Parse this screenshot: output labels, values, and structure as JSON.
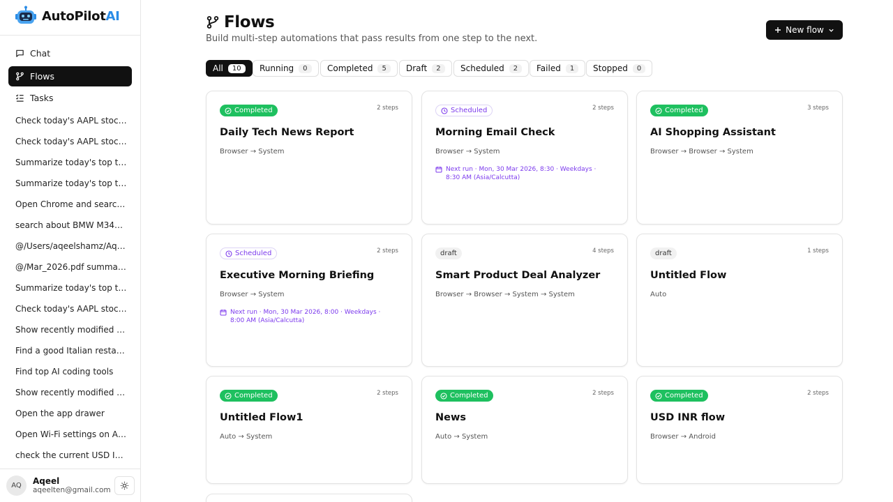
{
  "app": {
    "name": "AutoPilot",
    "name_accent": "AI",
    "accent_color": "#2b8ce6"
  },
  "nav": [
    {
      "label": "Chat",
      "icon": "chat-icon"
    },
    {
      "label": "Flows",
      "icon": "flow-icon",
      "active": true
    },
    {
      "label": "Tasks",
      "icon": "tasks-icon"
    }
  ],
  "history": [
    "Check today's AAPL stock ...",
    "Check today's AAPL stock ...",
    "Summarize today's top tec...",
    "Summarize today's top tec...",
    "Open Chrome and search f...",
    "search about BMW M340i ...",
    "@/Users/aqeelshamz/Aqe...",
    "@/Mar_2026.pdf summari...",
    "Summarize today's top tec...",
    "Check today's AAPL stock ...",
    "Show recently modified fil...",
    "Find a good Italian restaur...",
    "Find top AI coding tools",
    "Show recently modified fil...",
    "Open the app drawer",
    "Open Wi-Fi settings on An...",
    "check the current USD IN..."
  ],
  "user": {
    "initials": "AQ",
    "name": "Aqeel",
    "email": "aqeelten@gmail.com"
  },
  "header": {
    "title": "Flows",
    "subtitle": "Build multi-step automations that pass results from one step to the next.",
    "new_flow": "New flow"
  },
  "filters": [
    {
      "label": "All",
      "count": "10",
      "active": true
    },
    {
      "label": "Running",
      "count": "0"
    },
    {
      "label": "Completed",
      "count": "5"
    },
    {
      "label": "Draft",
      "count": "2"
    },
    {
      "label": "Scheduled",
      "count": "2"
    },
    {
      "label": "Failed",
      "count": "1"
    },
    {
      "label": "Stopped",
      "count": "0"
    }
  ],
  "flows": [
    {
      "status": "Completed",
      "status_type": "completed",
      "steps": "2 steps",
      "title": "Daily Tech News Report",
      "path": "Browser → System",
      "next": ""
    },
    {
      "status": "Scheduled",
      "status_type": "scheduled",
      "steps": "2 steps",
      "title": "Morning Email Check",
      "path": "Browser → System",
      "next": "Next run · Mon, 30 Mar 2026, 8:30 · Weekdays · 8:30 AM (Asia/Calcutta)"
    },
    {
      "status": "Completed",
      "status_type": "completed",
      "steps": "3 steps",
      "title": "AI Shopping Assistant",
      "path": "Browser → Browser → System",
      "next": ""
    },
    {
      "status": "Scheduled",
      "status_type": "scheduled",
      "steps": "2 steps",
      "title": "Executive Morning Briefing",
      "path": "Browser → System",
      "next": "Next run · Mon, 30 Mar 2026, 8:00 · Weekdays · 8:00 AM (Asia/Calcutta)"
    },
    {
      "status": "draft",
      "status_type": "draft",
      "steps": "4 steps",
      "title": "Smart Product Deal Analyzer",
      "path": "Browser → Browser → System → System",
      "next": ""
    },
    {
      "status": "draft",
      "status_type": "draft",
      "steps": "1 steps",
      "title": "Untitled Flow",
      "path": "Auto",
      "next": ""
    },
    {
      "status": "Completed",
      "status_type": "completed",
      "steps": "2 steps",
      "title": "Untitled Flow1",
      "path": "Auto → System",
      "next": ""
    },
    {
      "status": "Completed",
      "status_type": "completed",
      "steps": "2 steps",
      "title": "News",
      "path": "Auto → System",
      "next": ""
    },
    {
      "status": "Completed",
      "status_type": "completed",
      "steps": "2 steps",
      "title": "USD INR flow",
      "path": "Browser → Android",
      "next": ""
    }
  ],
  "colors": {
    "completed": "#1ec05f",
    "scheduled": "#7c3aed",
    "primary": "#111111"
  }
}
